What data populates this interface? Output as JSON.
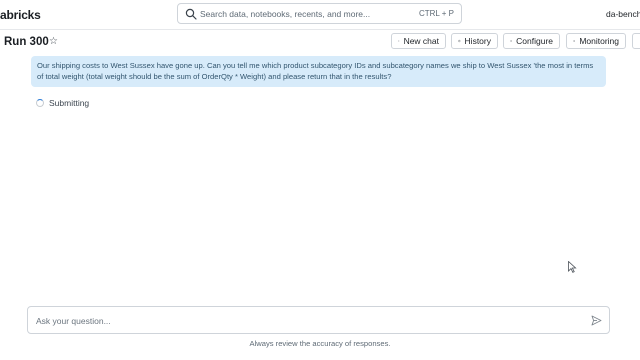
{
  "header": {
    "brand": "abricks",
    "search_placeholder": "Search data, notebooks, recents, and more...",
    "search_shortcut": "CTRL + P",
    "workspace": "da-bench"
  },
  "page": {
    "title": "Run 300",
    "buttons": {
      "new_chat": "New chat",
      "history": "History",
      "configure": "Configure",
      "monitoring": "Monitoring"
    }
  },
  "chat": {
    "user_message": "Our shipping costs to West Sussex have gone up. Can you tell me which product subcategory IDs and subcategory names we ship to West Sussex 'the most in terms of total weight (total weight should be the sum of OrderQty * Weight) and please return that in the results?",
    "status": "Submitting"
  },
  "composer": {
    "placeholder": "Ask your question...",
    "disclaimer": "Always review the accuracy of responses."
  },
  "colors": {
    "bubble_bg": "#d7ebfa",
    "bubble_text": "#33566f",
    "accent": "#2b7bd6"
  },
  "icons": [
    "search-icon",
    "star-icon",
    "plus-icon",
    "history-icon",
    "gear-icon",
    "eye-icon",
    "send-icon",
    "spinner-icon",
    "mouse-cursor-icon"
  ]
}
